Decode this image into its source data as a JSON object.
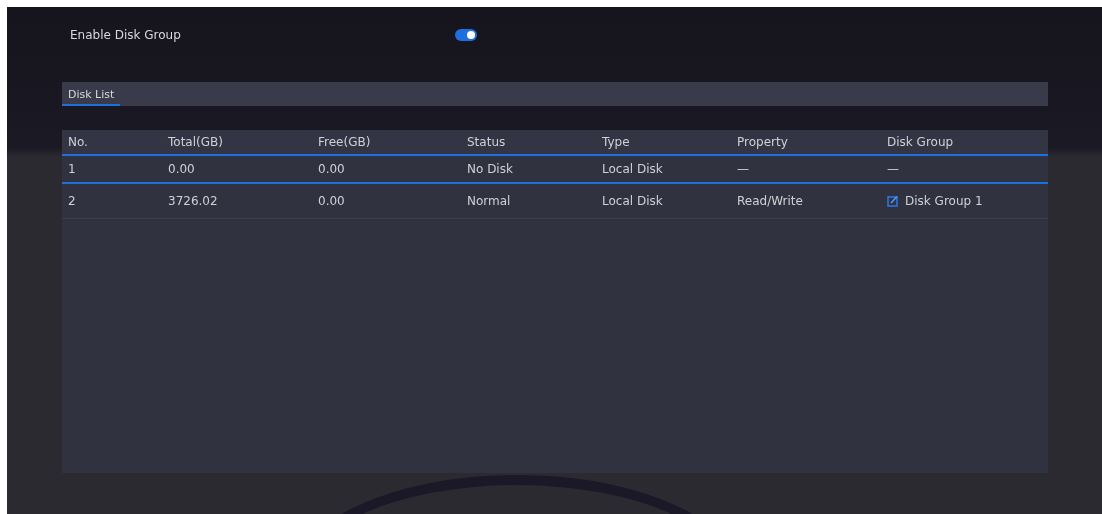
{
  "enable_disk_group": {
    "label": "Enable Disk Group",
    "on": true
  },
  "tabs": [
    {
      "label": "Disk List",
      "selected": true
    }
  ],
  "table": {
    "columns": [
      "No.",
      "Total(GB)",
      "Free(GB)",
      "Status",
      "Type",
      "Property",
      "Disk Group"
    ],
    "rows": [
      {
        "selected": true,
        "editable": false,
        "cells": [
          "1",
          "0.00",
          "0.00",
          "No Disk",
          "Local Disk",
          "—",
          "—"
        ]
      },
      {
        "selected": false,
        "editable": true,
        "cells": [
          "2",
          "3726.02",
          "0.00",
          "Normal",
          "Local Disk",
          "Read/Write",
          "Disk Group 1"
        ]
      }
    ]
  }
}
